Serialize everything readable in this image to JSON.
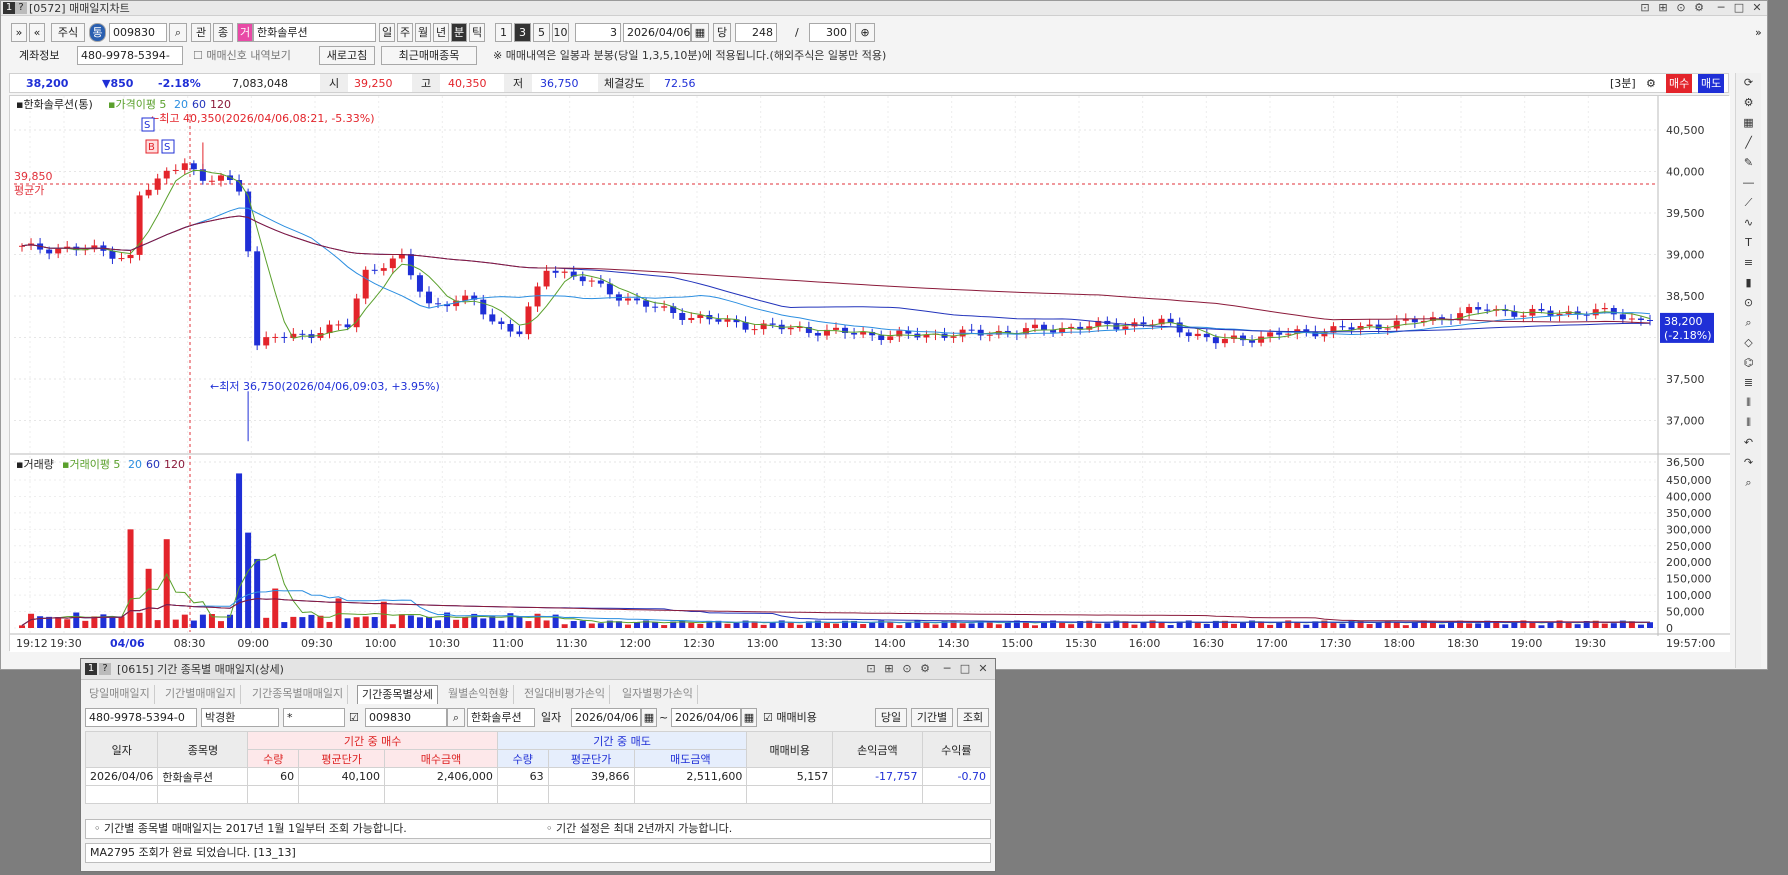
{
  "window": {
    "num": "1",
    "help": "?",
    "title": "[0572] 매매일지차트",
    "controls": [
      "⊡",
      "⊞",
      "⊙",
      "⚙",
      "─",
      "□",
      "✕"
    ]
  },
  "toolbar": {
    "expand": "»",
    "collapse": "«",
    "market": "주식",
    "type_tag": "통",
    "code": "009830",
    "search": "⌕",
    "rel": "관",
    "more": "종",
    "flag": "거",
    "name": "한화솔루션",
    "periods": [
      "일",
      "주",
      "월",
      "년",
      "분",
      "틱"
    ],
    "active_period": "분",
    "intervals": [
      "1",
      "3",
      "5",
      "10"
    ],
    "active_interval": "3",
    "custom_interval": "3",
    "date": "2026/04/06",
    "cal": "▦",
    "same": "당",
    "count": "248",
    "slash": "/",
    "max": "300",
    "zoom": "⊕",
    "right_arrow": "»"
  },
  "account": {
    "label": "계좌정보",
    "number": "480-9978-5394-",
    "checkbox_label": "매매신호 내역보기",
    "refresh": "새로고침",
    "recent": "최근매매종목",
    "notice": "※ 매매내역은 일봉과 분봉(당일 1,3,5,10분)에 적용됩니다.(해외주식은 일봉만 적용)"
  },
  "price": {
    "current": "38,200",
    "change": "▼850",
    "rate": "-2.18%",
    "volume": "7,083,048",
    "open_label": "시",
    "open": "39,250",
    "high_label": "고",
    "high": "40,350",
    "low_label": "저",
    "low": "36,750",
    "strength_label": "체결강도",
    "strength": "72.56",
    "interval_tag": "[3분]",
    "buy": "매수",
    "sell": "매도"
  },
  "chart": {
    "legend_name": "한화솔루션(통)",
    "legend_ma": "가격이평",
    "ma": [
      "5",
      "20",
      "60",
      "120"
    ],
    "high_note": "←최고 40,350(2026/04/06,08:21, -5.33%)",
    "low_note": "←최저 36,750(2026/04/06,09:03, +3.95%)",
    "avg_value": "39,850",
    "avg_label": "평균가",
    "current_tag": "38,200",
    "current_rate": "(-2.18%)",
    "vol_legend": "거래량",
    "vol_ma": "거래이평",
    "vol_ma_values": [
      "5",
      "20",
      "60",
      "120"
    ],
    "price_ticks": [
      "40,500",
      "40,000",
      "39,500",
      "39,000",
      "38,500",
      "38,000",
      "37,500",
      "37,000",
      "36,500"
    ],
    "vol_ticks": [
      "450,000",
      "400,000",
      "350,000",
      "300,000",
      "250,000",
      "200,000",
      "150,000",
      "100,000",
      "50,000",
      "0"
    ],
    "time_ticks": [
      "19:12",
      "19:30",
      "04/06",
      "08:30",
      "09:00",
      "09:30",
      "10:00",
      "10:30",
      "11:00",
      "11:30",
      "12:00",
      "12:30",
      "13:00",
      "13:30",
      "14:00",
      "14:30",
      "15:00",
      "15:30",
      "16:00",
      "16:30",
      "17:00",
      "17:30",
      "18:00",
      "18:30",
      "19:00",
      "19:30"
    ],
    "end_time": "19:57:00",
    "markers": [
      "S",
      "B",
      "S"
    ]
  },
  "chart_data": {
    "type": "candlestick",
    "title": "한화솔루션(통)",
    "interval": "3분",
    "price_range": [
      36500,
      40500
    ],
    "avg_price": 39850,
    "high": 40350,
    "low": 36750,
    "last": 38200,
    "volume_range": [
      0,
      450000
    ],
    "close_path": [
      [
        0,
        39080
      ],
      [
        8,
        39060
      ],
      [
        12,
        38960
      ],
      [
        13,
        39700
      ],
      [
        16,
        39980
      ],
      [
        18,
        40150
      ],
      [
        20,
        39850
      ],
      [
        22,
        39950
      ],
      [
        24,
        39780
      ],
      [
        25,
        39100
      ],
      [
        26,
        37900
      ],
      [
        28,
        38000
      ],
      [
        32,
        38050
      ],
      [
        36,
        38150
      ],
      [
        38,
        38800
      ],
      [
        42,
        38950
      ],
      [
        45,
        38400
      ],
      [
        50,
        38450
      ],
      [
        52,
        38200
      ],
      [
        55,
        38050
      ],
      [
        58,
        38850
      ],
      [
        62,
        38700
      ],
      [
        66,
        38500
      ],
      [
        70,
        38350
      ],
      [
        74,
        38250
      ],
      [
        80,
        38150
      ],
      [
        88,
        38080
      ],
      [
        96,
        38020
      ],
      [
        106,
        38050
      ],
      [
        116,
        38120
      ],
      [
        126,
        38180
      ],
      [
        132,
        37950
      ],
      [
        140,
        38050
      ],
      [
        148,
        38120
      ],
      [
        156,
        38220
      ],
      [
        162,
        38350
      ],
      [
        166,
        38280
      ],
      [
        170,
        38300
      ],
      [
        176,
        38300
      ],
      [
        178,
        38220
      ],
      [
        180,
        38200
      ]
    ],
    "volume_peaks": [
      [
        12,
        300000
      ],
      [
        14,
        180000
      ],
      [
        16,
        270000
      ],
      [
        24,
        470000
      ],
      [
        25,
        290000
      ],
      [
        26,
        210000
      ],
      [
        28,
        120000
      ],
      [
        35,
        90000
      ],
      [
        40,
        80000
      ]
    ]
  },
  "sub": {
    "num": "1",
    "help": "?",
    "title": "[0615] 기간 종목별 매매일지(상세)",
    "controls": [
      "⊡",
      "⊞",
      "⊙",
      "⚙",
      "─",
      "□",
      "✕"
    ],
    "tabs": [
      "당일매매일지",
      "기간별매매일지",
      "기간종목별매매일지",
      "기간종목별상세",
      "월별손익현황",
      "전일대비평가손익",
      "일자별평가손익"
    ],
    "active_tab": "기간종목별상세",
    "account": "480-9978-5394-0",
    "owner": "박경환",
    "pwd": "*",
    "code": "009830",
    "name": "한화솔루션",
    "date_label": "일자",
    "from": "2026/04/06",
    "to": "2026/04/06",
    "tilde": "~",
    "fee_check": "매매비용",
    "btn_today": "당일",
    "btn_period": "기간별",
    "btn_query": "조회",
    "header": {
      "date": "일자",
      "item": "종목명",
      "buy_group": "기간 중 매수",
      "sell_group": "기간 중 매도",
      "qty": "수량",
      "avg": "평균단가",
      "buy_amt": "매수금액",
      "sell_amt": "매도금액",
      "fee": "매매비용",
      "pnl": "손익금액",
      "rate": "수익률"
    },
    "row": {
      "date": "2026/04/06",
      "item": "한화솔루션",
      "buy_qty": "60",
      "buy_avg": "40,100",
      "buy_amt": "2,406,000",
      "sell_qty": "63",
      "sell_avg": "39,866",
      "sell_amt": "2,511,600",
      "fee": "5,157",
      "pnl": "-17,757",
      "rate": "-0.70"
    },
    "note1": "◦ 기간별 종목별 매매일지는 2017년 1월 1일부터 조회 가능합니다.",
    "note2": "◦ 기간 설정은 최대 2년까지 가능합니다.",
    "status": "MA2795 조회가 완료 되었습니다. [13_13]"
  },
  "colors": {
    "up": "#e3242b",
    "down": "#1f2fd6",
    "ma5": "#5aa02c",
    "ma20": "#2b8ee0",
    "ma60": "#2233bb",
    "ma120": "#8b1a3a",
    "avg": "#e0303a"
  }
}
